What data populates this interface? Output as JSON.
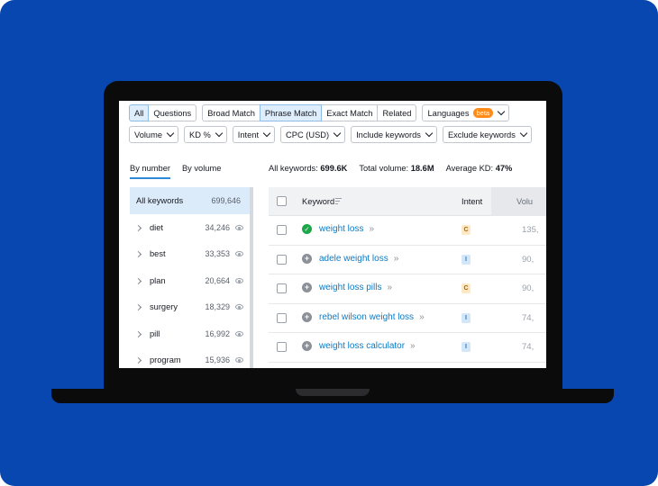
{
  "filters": {
    "match_tabs": [
      "All",
      "Questions"
    ],
    "match_types": [
      "Broad Match",
      "Phrase Match",
      "Exact Match",
      "Related"
    ],
    "languages_label": "Languages",
    "languages_badge": "beta",
    "dropdowns": [
      "Volume",
      "KD %",
      "Intent",
      "CPC (USD)",
      "Include keywords",
      "Exclude keywords"
    ]
  },
  "view_tabs": {
    "by_number": "By number",
    "by_volume": "By volume"
  },
  "stats": {
    "all_keywords_label": "All keywords:",
    "all_keywords_value": "699.6K",
    "total_volume_label": "Total volume:",
    "total_volume_value": "18.6M",
    "average_kd_label": "Average KD:",
    "average_kd_value": "47%"
  },
  "sidebar": {
    "header_label": "All keywords",
    "header_count": "699,646",
    "items": [
      {
        "label": "diet",
        "count": "34,246"
      },
      {
        "label": "best",
        "count": "33,353"
      },
      {
        "label": "plan",
        "count": "20,664"
      },
      {
        "label": "surgery",
        "count": "18,329"
      },
      {
        "label": "pill",
        "count": "16,992"
      },
      {
        "label": "program",
        "count": "15,936"
      }
    ]
  },
  "table": {
    "headers": {
      "keyword": "Keyword",
      "intent": "Intent",
      "volume": "Volu"
    },
    "rows": [
      {
        "keyword": "weight loss",
        "arrows": "»",
        "intent": "C",
        "volume": "135,",
        "status": "✓"
      },
      {
        "keyword": "adele weight loss",
        "arrows": "»",
        "intent": "I",
        "volume": "90,",
        "status": "+"
      },
      {
        "keyword": "weight loss pills",
        "arrows": "»",
        "intent": "C",
        "volume": "90,",
        "status": "+"
      },
      {
        "keyword": "rebel wilson weight loss",
        "arrows": "»",
        "intent": "I",
        "volume": "74,",
        "status": "+"
      },
      {
        "keyword": "weight loss calculator",
        "arrows": "»",
        "intent": "I",
        "volume": "74,",
        "status": "+"
      }
    ]
  },
  "colors": {
    "background": "#0847b0",
    "accent": "#0d7ac4",
    "beta_badge": "#ff8c1a"
  }
}
